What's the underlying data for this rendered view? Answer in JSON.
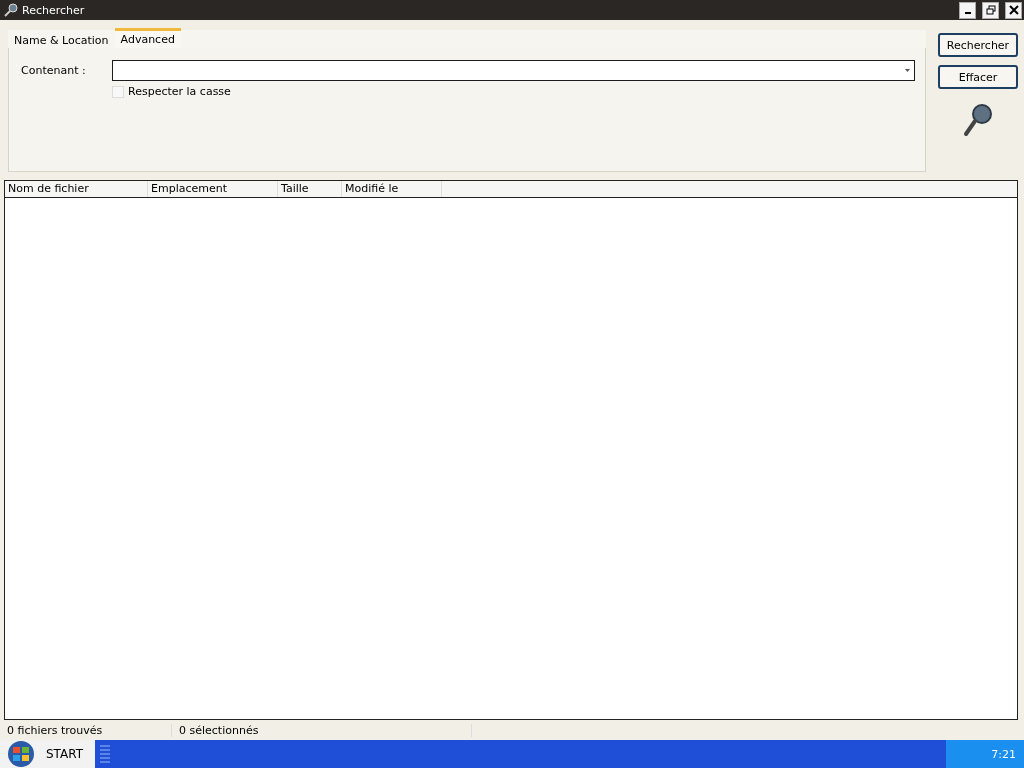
{
  "window": {
    "title": "Rechercher"
  },
  "tabs": [
    {
      "label": "Name & Location",
      "selected": false
    },
    {
      "label": "Advanced",
      "selected": true
    }
  ],
  "form": {
    "contains_label": "Contenant :",
    "match_case": {
      "label": "Respecter la casse",
      "checked": false
    }
  },
  "buttons": [
    "Rechercher",
    "Effacer"
  ],
  "table": {
    "columns": [
      "Nom de fichier",
      "Emplacement",
      "Taille",
      "Modifié le"
    ]
  },
  "status_bar": [
    "0 fichiers trouvés",
    "0 sélectionnés"
  ],
  "taskbar": {
    "start": "START",
    "clock": "7:21"
  }
}
